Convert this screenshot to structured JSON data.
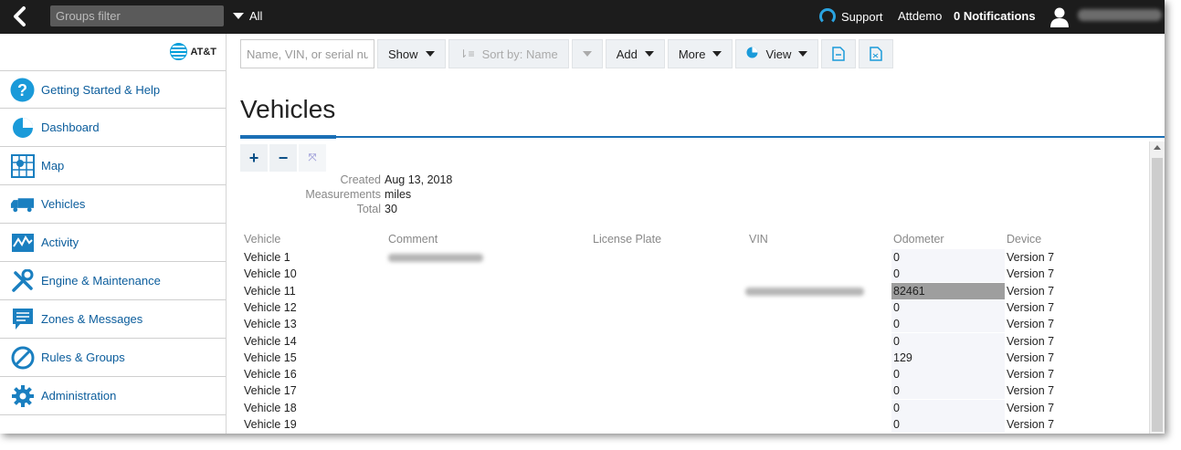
{
  "topbar": {
    "groups_filter_placeholder": "Groups filter",
    "all_label": "All",
    "support_label": "Support",
    "user_label": "Attdemo",
    "notifications_label": "0 Notifications"
  },
  "sidebar": {
    "logo_text": "AT&T",
    "items": [
      {
        "label": "Getting Started & Help",
        "icon": "help-icon"
      },
      {
        "label": "Dashboard",
        "icon": "dashboard-icon"
      },
      {
        "label": "Map",
        "icon": "map-icon"
      },
      {
        "label": "Vehicles",
        "icon": "truck-icon"
      },
      {
        "label": "Activity",
        "icon": "activity-icon"
      },
      {
        "label": "Engine & Maintenance",
        "icon": "wrench-icon"
      },
      {
        "label": "Zones & Messages",
        "icon": "message-icon"
      },
      {
        "label": "Rules & Groups",
        "icon": "rules-icon"
      },
      {
        "label": "Administration",
        "icon": "gear-icon"
      }
    ]
  },
  "toolbar": {
    "search_placeholder": "Name, VIN, or serial number",
    "show_label": "Show",
    "sort_label": "Sort by: Name",
    "add_label": "Add",
    "more_label": "More",
    "view_label": "View"
  },
  "page": {
    "title": "Vehicles"
  },
  "meta": {
    "created_label": "Created",
    "created_value": "Aug 13, 2018",
    "measurements_label": "Measurements",
    "measurements_value": "miles",
    "total_label": "Total",
    "total_value": "30"
  },
  "table": {
    "columns": [
      "Vehicle",
      "Comment",
      "License Plate",
      "VIN",
      "Odometer",
      "Device"
    ],
    "rows": [
      {
        "vehicle": "Vehicle 1",
        "odometer": "0",
        "device": "Version 7"
      },
      {
        "vehicle": "Vehicle 10",
        "odometer": "0",
        "device": "Version 7"
      },
      {
        "vehicle": "Vehicle 11",
        "odometer": "82461",
        "device": "Version 7"
      },
      {
        "vehicle": "Vehicle 12",
        "odometer": "0",
        "device": "Version 7"
      },
      {
        "vehicle": "Vehicle 13",
        "odometer": "0",
        "device": "Version 7"
      },
      {
        "vehicle": "Vehicle 14",
        "odometer": "0",
        "device": "Version 7"
      },
      {
        "vehicle": "Vehicle 15",
        "odometer": "129",
        "device": "Version 7"
      },
      {
        "vehicle": "Vehicle 16",
        "odometer": "0",
        "device": "Version 7"
      },
      {
        "vehicle": "Vehicle 17",
        "odometer": "0",
        "device": "Version 7"
      },
      {
        "vehicle": "Vehicle 18",
        "odometer": "0",
        "device": "Version 7"
      },
      {
        "vehicle": "Vehicle 19",
        "odometer": "0",
        "device": "Version 7"
      }
    ]
  },
  "colors": {
    "accent": "#1b6fb5",
    "nav_text": "#0b5d9c",
    "topbar_bg": "#1c1c1c"
  }
}
